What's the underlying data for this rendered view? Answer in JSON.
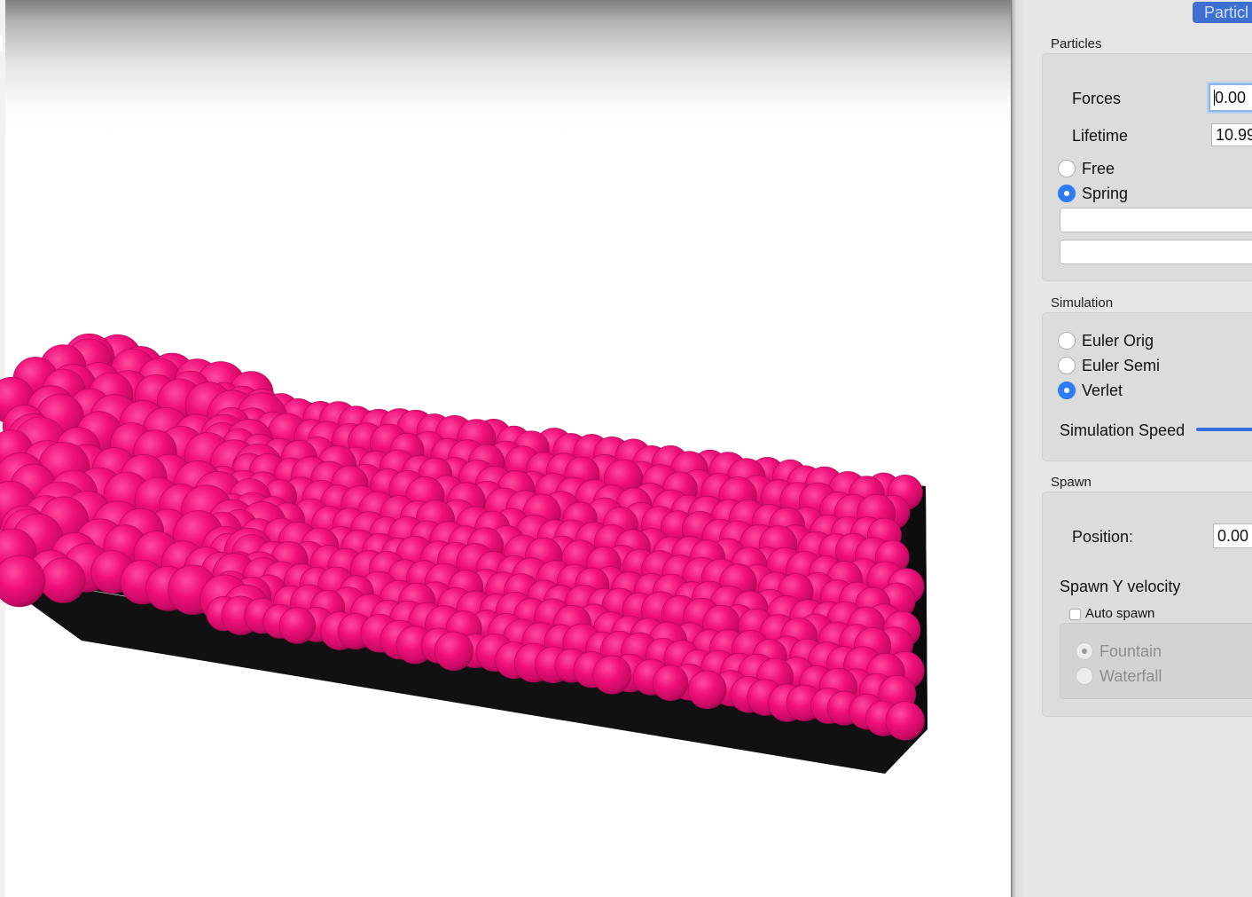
{
  "panel": {
    "tab_label": "Particl",
    "particles": {
      "title": "Particles",
      "forces_label": "Forces",
      "forces_value": "0.00",
      "lifetime_label": "Lifetime",
      "lifetime_value": "10.99",
      "mode_options": [
        {
          "label": "Free",
          "checked": false
        },
        {
          "label": "Spring",
          "checked": true
        }
      ]
    },
    "simulation": {
      "title": "Simulation",
      "methods": [
        {
          "label": "Euler Orig",
          "checked": false
        },
        {
          "label": "Euler Semi",
          "checked": false
        },
        {
          "label": "Verlet",
          "checked": true
        }
      ],
      "speed_label": "Simulation Speed"
    },
    "spawn": {
      "title": "Spawn",
      "position_label": "Position:",
      "position_value": "0.00",
      "velocity_label": "Spawn Y velocity",
      "auto_spawn_label": "Auto spawn",
      "auto_spawn_checked": false,
      "spawn_modes": [
        {
          "label": "Fountain",
          "checked": true,
          "disabled": true
        },
        {
          "label": "Waterfall",
          "checked": false,
          "disabled": true
        }
      ]
    }
  },
  "scene": {
    "particle_color": "#f0107a",
    "container_color": "#121214",
    "background_color": "#ffffff"
  }
}
